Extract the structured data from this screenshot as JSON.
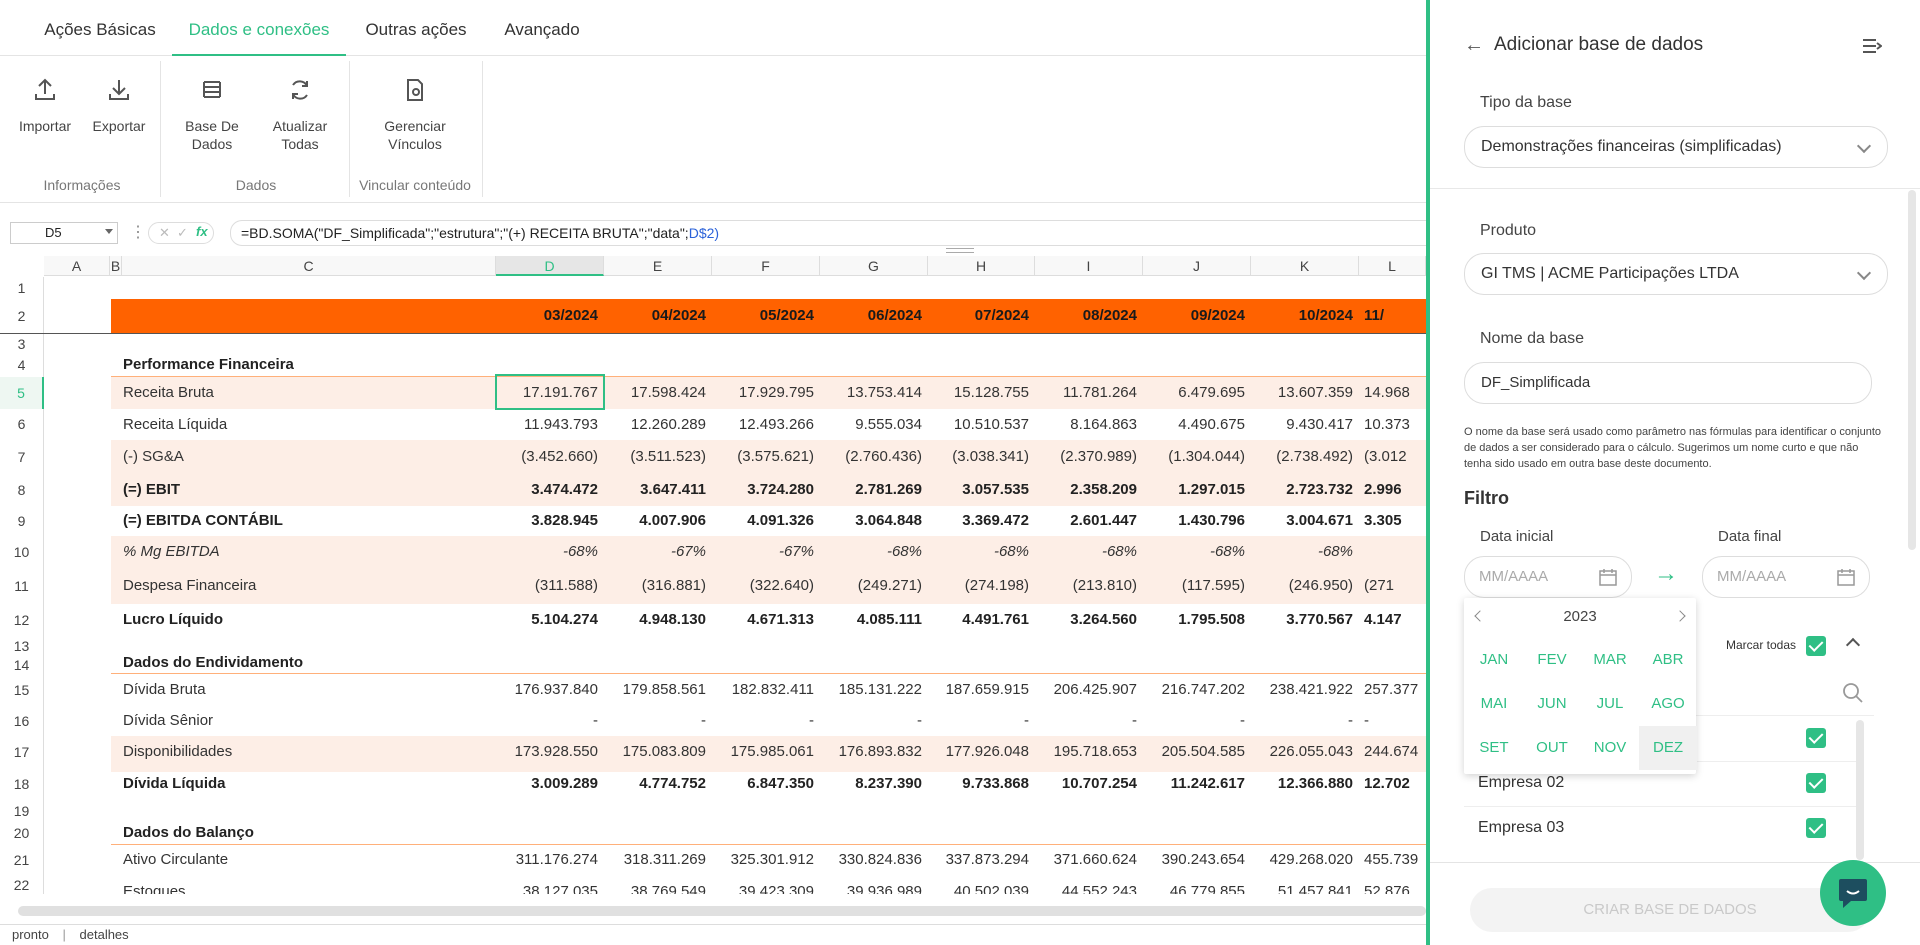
{
  "tabs": [
    "Ações Básicas",
    "Dados e conexões",
    "Outras ações",
    "Avançado"
  ],
  "ribbon": {
    "importar": "Importar",
    "exportar": "Exportar",
    "base1": "Base De",
    "base2": "Dados",
    "atual1": "Atualizar",
    "atual2": "Todas",
    "ger1": "Gerenciar",
    "ger2": "Vínculos",
    "g_info": "Informações",
    "g_dados": "Dados",
    "g_vinc": "Vincular conteúdo"
  },
  "formula": {
    "cell": "D5",
    "fx": "fx",
    "text": "=BD.SOMA(\"DF_Simplificada\";\"estrutura\";\"(+) RECEITA BRUTA\";\"data\";",
    "ref": "D$2)"
  },
  "cols": [
    "A",
    "B",
    "C",
    "D",
    "E",
    "F",
    "G",
    "H",
    "I",
    "J",
    "K",
    "L"
  ],
  "rows": [
    "1",
    "2",
    "3",
    "4",
    "5",
    "6",
    "7",
    "8",
    "9",
    "10",
    "11",
    "12",
    "13",
    "14",
    "15",
    "16",
    "17",
    "18",
    "19",
    "20",
    "21",
    "22"
  ],
  "dates": [
    "03/2024",
    "04/2024",
    "05/2024",
    "06/2024",
    "07/2024",
    "08/2024",
    "09/2024",
    "10/2024",
    "11/"
  ],
  "sections": {
    "perf": "Performance Financeira",
    "endiv": "Dados do Endividamento",
    "bal": "Dados do Balanço"
  },
  "lines": [
    {
      "label": "Receita Bruta",
      "vals": [
        "17.191.767",
        "17.598.424",
        "17.929.795",
        "13.753.414",
        "15.128.755",
        "11.781.264",
        "6.479.695",
        "13.607.359",
        "14.968"
      ]
    },
    {
      "label": "Receita Líquida",
      "vals": [
        "11.943.793",
        "12.260.289",
        "12.493.266",
        "9.555.034",
        "10.510.537",
        "8.164.863",
        "4.490.675",
        "9.430.417",
        "10.373"
      ]
    },
    {
      "label": "(-) SG&A",
      "vals": [
        "(3.452.660)",
        "(3.511.523)",
        "(3.575.621)",
        "(2.760.436)",
        "(3.038.341)",
        "(2.370.989)",
        "(1.304.044)",
        "(2.738.492)",
        "(3.012"
      ]
    },
    {
      "label": "(=) EBIT",
      "vals": [
        "3.474.472",
        "3.647.411",
        "3.724.280",
        "2.781.269",
        "3.057.535",
        "2.358.209",
        "1.297.015",
        "2.723.732",
        "2.996"
      ]
    },
    {
      "label": "(=) EBITDA CONTÁBIL",
      "vals": [
        "3.828.945",
        "4.007.906",
        "4.091.326",
        "3.064.848",
        "3.369.472",
        "2.601.447",
        "1.430.796",
        "3.004.671",
        "3.305"
      ]
    },
    {
      "label": "% Mg EBITDA",
      "vals": [
        "-68%",
        "-67%",
        "-67%",
        "-68%",
        "-68%",
        "-68%",
        "-68%",
        "-68%",
        ""
      ]
    },
    {
      "label": "Despesa Financeira",
      "vals": [
        "(311.588)",
        "(316.881)",
        "(322.640)",
        "(249.271)",
        "(274.198)",
        "(213.810)",
        "(117.595)",
        "(246.950)",
        "(271"
      ]
    },
    {
      "label": "Lucro Líquido",
      "vals": [
        "5.104.274",
        "4.948.130",
        "4.671.313",
        "4.085.111",
        "4.491.761",
        "3.264.560",
        "1.795.508",
        "3.770.567",
        "4.147"
      ]
    },
    {
      "label": "Dívida Bruta",
      "vals": [
        "176.937.840",
        "179.858.561",
        "182.832.411",
        "185.131.222",
        "187.659.915",
        "206.425.907",
        "216.747.202",
        "238.421.922",
        "257.377"
      ]
    },
    {
      "label": "Dívida Sênior",
      "vals": [
        "-",
        "-",
        "-",
        "-",
        "-",
        "-",
        "-",
        "-",
        "-"
      ]
    },
    {
      "label": "Disponibilidades",
      "vals": [
        "173.928.550",
        "175.083.809",
        "175.985.061",
        "176.893.832",
        "177.926.048",
        "195.718.653",
        "205.504.585",
        "226.055.043",
        "244.674"
      ]
    },
    {
      "label": "Dívida Líquida",
      "vals": [
        "3.009.289",
        "4.774.752",
        "6.847.350",
        "8.237.390",
        "9.733.868",
        "10.707.254",
        "11.242.617",
        "12.366.880",
        "12.702"
      ]
    },
    {
      "label": "Ativo Circulante",
      "vals": [
        "311.176.274",
        "318.311.269",
        "325.301.912",
        "330.824.836",
        "337.873.294",
        "371.660.624",
        "390.243.654",
        "429.268.020",
        "455.739"
      ]
    },
    {
      "label": "Estoques",
      "vals": [
        "38.127.035",
        "38.769.549",
        "39.423.309",
        "39.936.989",
        "40.502.039",
        "44.552.243",
        "46.779.855",
        "51.457.841",
        "52.876"
      ]
    }
  ],
  "status": {
    "a": "pronto",
    "sep": "|",
    "b": "detalhes"
  },
  "panel": {
    "title": "Adicionar base de dados",
    "tipo_label": "Tipo da base",
    "tipo_value": "Demonstrações financeiras (simplificadas)",
    "produto_label": "Produto",
    "produto_value": "GI TMS | ACME Participações LTDA",
    "nome_label": "Nome da base",
    "nome_value": "DF_Simplificada",
    "help": "O nome da base será usado como parâmetro nas fórmulas para identificar o conjunto de dados a ser considerado para o cálculo. Sugerimos um nome curto e que não tenha sido usado em outra base deste documento.",
    "filtro": "Filtro",
    "data_inicial": "Data inicial",
    "data_final": "Data final",
    "date_placeholder": "MM/AAAA",
    "year": "2023",
    "months": [
      "JAN",
      "FEV",
      "MAR",
      "ABR",
      "MAI",
      "JUN",
      "JUL",
      "AGO",
      "SET",
      "OUT",
      "NOV",
      "DEZ"
    ],
    "marcar": "Marcar todas",
    "empresas": [
      "Empresa 02",
      "Empresa 03"
    ],
    "criar": "CRIAR BASE DE DADOS"
  },
  "colors": {
    "accent": "#2fbf85",
    "header_band": "#ff6200",
    "band_light": "#fdeee6",
    "ref": "#2b62d9"
  }
}
